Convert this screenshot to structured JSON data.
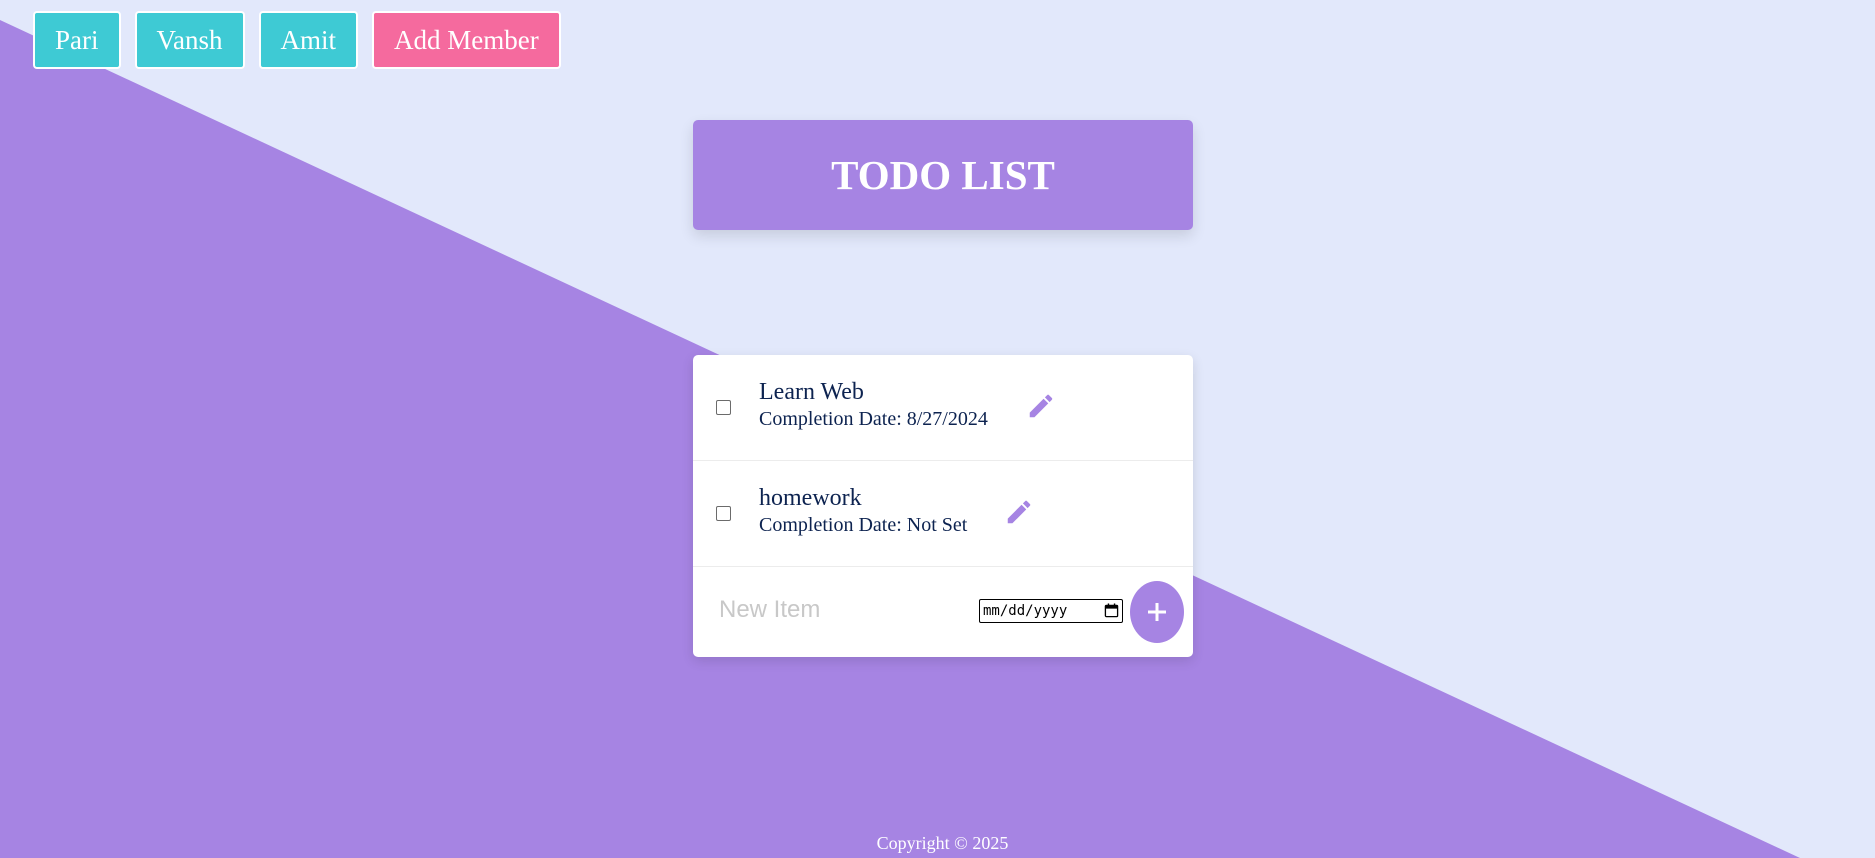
{
  "members": {
    "buttons": [
      {
        "label": "Pari"
      },
      {
        "label": "Vansh"
      },
      {
        "label": "Amit"
      }
    ],
    "add_label": "Add Member"
  },
  "header": {
    "title": "TODO LIST"
  },
  "todos": [
    {
      "title": "Learn Web",
      "date_text": "Completion Date: 8/27/2024",
      "checked": false
    },
    {
      "title": "homework",
      "date_text": "Completion Date: Not Set",
      "checked": false
    }
  ],
  "new_item": {
    "placeholder": "New Item",
    "date_placeholder": "mm/dd/yyyy",
    "add_icon": "plus-icon"
  },
  "icons": {
    "edit": "pencil-icon",
    "calendar": "calendar-icon"
  },
  "colors": {
    "accent": "#a684e3",
    "member_button": "#3ecad4",
    "add_member_button": "#f56a9e",
    "background": "#e2e8fb",
    "text": "#0d2350"
  },
  "footer": {
    "text": "Copyright © 2025"
  }
}
